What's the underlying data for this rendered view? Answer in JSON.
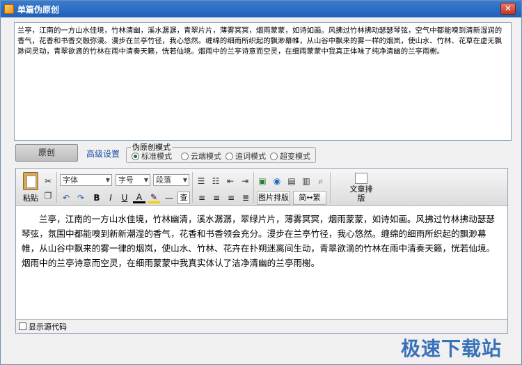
{
  "window": {
    "title": "单篇伪原创"
  },
  "source_text": "兰亭，江南的一方山水佳境，竹林清幽，溪水潺潺，青翠片片，薄雾冥冥，烟雨蒙蒙，如诗如画。风拂过竹林拂动瑟瑟琴弦，空气中都能嗅到清新湿润的香气，花香和书香交融弥漫。漫步在兰亭竹径，我心悠然。缠绵的细雨所织起的飘渺幕帷，从山谷中飘来的雾一样的烟岚，使山水、竹林、花草在虚无飘渺间灵动，青翠欲滴的竹林在雨中清奏天籁，恍若仙境。烟雨中的兰亭诗意而空灵，在细雨蒙蒙中我真正体味了纯净清幽的兰亭雨榭。",
  "controls": {
    "original_button": "原创",
    "advanced_link": "高级设置",
    "mode_group_label": "伪原创模式",
    "modes": [
      {
        "label": "标准模式",
        "selected": true
      },
      {
        "label": "云端模式",
        "selected": false
      },
      {
        "label": "追词模式",
        "selected": false
      },
      {
        "label": "超变模式",
        "selected": false
      }
    ]
  },
  "toolbar": {
    "paste": "粘贴",
    "font": "字体",
    "size": "字号",
    "paragraph": "段落",
    "bold": "B",
    "italic": "I",
    "underline": "U",
    "font_color": "A",
    "image_layout": "图片排版",
    "simp_trad": "简↔繁",
    "article_typeset": "文章排版",
    "check": "查"
  },
  "editor_text": "兰亭，江南的一方山水佳境，竹林幽清，溪水潺潺，翠绿片片，薄雾冥冥，烟雨蒙蒙，如诗如画。风拂过竹林拂动瑟瑟琴弦，氛围中都能嗅到新新潮湿的香气，花香和书香领会充分。漫步在兰亭竹径，我心悠然。缠绵的细雨所织起的飘渺幕帷，从山谷中飘来的雾一律的烟岚，使山水、竹林、花卉在扑朔迷离间生动，青翠欲滴的竹林在雨中清奏天籁，恍若仙境。烟雨中的兰亭诗意而空灵，在细雨蒙蒙中我真实体认了洁净清幽的兰亭雨榭。",
  "footer": {
    "show_source": "显示源代码"
  },
  "watermark": "极速下载站"
}
